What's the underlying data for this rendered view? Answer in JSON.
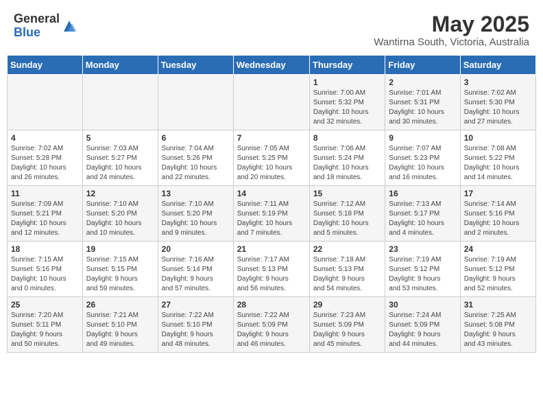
{
  "logo": {
    "general": "General",
    "blue": "Blue"
  },
  "title": "May 2025",
  "location": "Wantirna South, Victoria, Australia",
  "days_of_week": [
    "Sunday",
    "Monday",
    "Tuesday",
    "Wednesday",
    "Thursday",
    "Friday",
    "Saturday"
  ],
  "weeks": [
    [
      {
        "day": "",
        "info": ""
      },
      {
        "day": "",
        "info": ""
      },
      {
        "day": "",
        "info": ""
      },
      {
        "day": "",
        "info": ""
      },
      {
        "day": "1",
        "info": "Sunrise: 7:00 AM\nSunset: 5:32 PM\nDaylight: 10 hours\nand 32 minutes."
      },
      {
        "day": "2",
        "info": "Sunrise: 7:01 AM\nSunset: 5:31 PM\nDaylight: 10 hours\nand 30 minutes."
      },
      {
        "day": "3",
        "info": "Sunrise: 7:02 AM\nSunset: 5:30 PM\nDaylight: 10 hours\nand 27 minutes."
      }
    ],
    [
      {
        "day": "4",
        "info": "Sunrise: 7:02 AM\nSunset: 5:28 PM\nDaylight: 10 hours\nand 26 minutes."
      },
      {
        "day": "5",
        "info": "Sunrise: 7:03 AM\nSunset: 5:27 PM\nDaylight: 10 hours\nand 24 minutes."
      },
      {
        "day": "6",
        "info": "Sunrise: 7:04 AM\nSunset: 5:26 PM\nDaylight: 10 hours\nand 22 minutes."
      },
      {
        "day": "7",
        "info": "Sunrise: 7:05 AM\nSunset: 5:25 PM\nDaylight: 10 hours\nand 20 minutes."
      },
      {
        "day": "8",
        "info": "Sunrise: 7:06 AM\nSunset: 5:24 PM\nDaylight: 10 hours\nand 18 minutes."
      },
      {
        "day": "9",
        "info": "Sunrise: 7:07 AM\nSunset: 5:23 PM\nDaylight: 10 hours\nand 16 minutes."
      },
      {
        "day": "10",
        "info": "Sunrise: 7:08 AM\nSunset: 5:22 PM\nDaylight: 10 hours\nand 14 minutes."
      }
    ],
    [
      {
        "day": "11",
        "info": "Sunrise: 7:09 AM\nSunset: 5:21 PM\nDaylight: 10 hours\nand 12 minutes."
      },
      {
        "day": "12",
        "info": "Sunrise: 7:10 AM\nSunset: 5:20 PM\nDaylight: 10 hours\nand 10 minutes."
      },
      {
        "day": "13",
        "info": "Sunrise: 7:10 AM\nSunset: 5:20 PM\nDaylight: 10 hours\nand 9 minutes."
      },
      {
        "day": "14",
        "info": "Sunrise: 7:11 AM\nSunset: 5:19 PM\nDaylight: 10 hours\nand 7 minutes."
      },
      {
        "day": "15",
        "info": "Sunrise: 7:12 AM\nSunset: 5:18 PM\nDaylight: 10 hours\nand 5 minutes."
      },
      {
        "day": "16",
        "info": "Sunrise: 7:13 AM\nSunset: 5:17 PM\nDaylight: 10 hours\nand 4 minutes."
      },
      {
        "day": "17",
        "info": "Sunrise: 7:14 AM\nSunset: 5:16 PM\nDaylight: 10 hours\nand 2 minutes."
      }
    ],
    [
      {
        "day": "18",
        "info": "Sunrise: 7:15 AM\nSunset: 5:16 PM\nDaylight: 10 hours\nand 0 minutes."
      },
      {
        "day": "19",
        "info": "Sunrise: 7:15 AM\nSunset: 5:15 PM\nDaylight: 9 hours\nand 59 minutes."
      },
      {
        "day": "20",
        "info": "Sunrise: 7:16 AM\nSunset: 5:14 PM\nDaylight: 9 hours\nand 57 minutes."
      },
      {
        "day": "21",
        "info": "Sunrise: 7:17 AM\nSunset: 5:13 PM\nDaylight: 9 hours\nand 56 minutes."
      },
      {
        "day": "22",
        "info": "Sunrise: 7:18 AM\nSunset: 5:13 PM\nDaylight: 9 hours\nand 54 minutes."
      },
      {
        "day": "23",
        "info": "Sunrise: 7:19 AM\nSunset: 5:12 PM\nDaylight: 9 hours\nand 53 minutes."
      },
      {
        "day": "24",
        "info": "Sunrise: 7:19 AM\nSunset: 5:12 PM\nDaylight: 9 hours\nand 52 minutes."
      }
    ],
    [
      {
        "day": "25",
        "info": "Sunrise: 7:20 AM\nSunset: 5:11 PM\nDaylight: 9 hours\nand 50 minutes."
      },
      {
        "day": "26",
        "info": "Sunrise: 7:21 AM\nSunset: 5:10 PM\nDaylight: 9 hours\nand 49 minutes."
      },
      {
        "day": "27",
        "info": "Sunrise: 7:22 AM\nSunset: 5:10 PM\nDaylight: 9 hours\nand 48 minutes."
      },
      {
        "day": "28",
        "info": "Sunrise: 7:22 AM\nSunset: 5:09 PM\nDaylight: 9 hours\nand 46 minutes."
      },
      {
        "day": "29",
        "info": "Sunrise: 7:23 AM\nSunset: 5:09 PM\nDaylight: 9 hours\nand 45 minutes."
      },
      {
        "day": "30",
        "info": "Sunrise: 7:24 AM\nSunset: 5:09 PM\nDaylight: 9 hours\nand 44 minutes."
      },
      {
        "day": "31",
        "info": "Sunrise: 7:25 AM\nSunset: 5:08 PM\nDaylight: 9 hours\nand 43 minutes."
      }
    ]
  ]
}
